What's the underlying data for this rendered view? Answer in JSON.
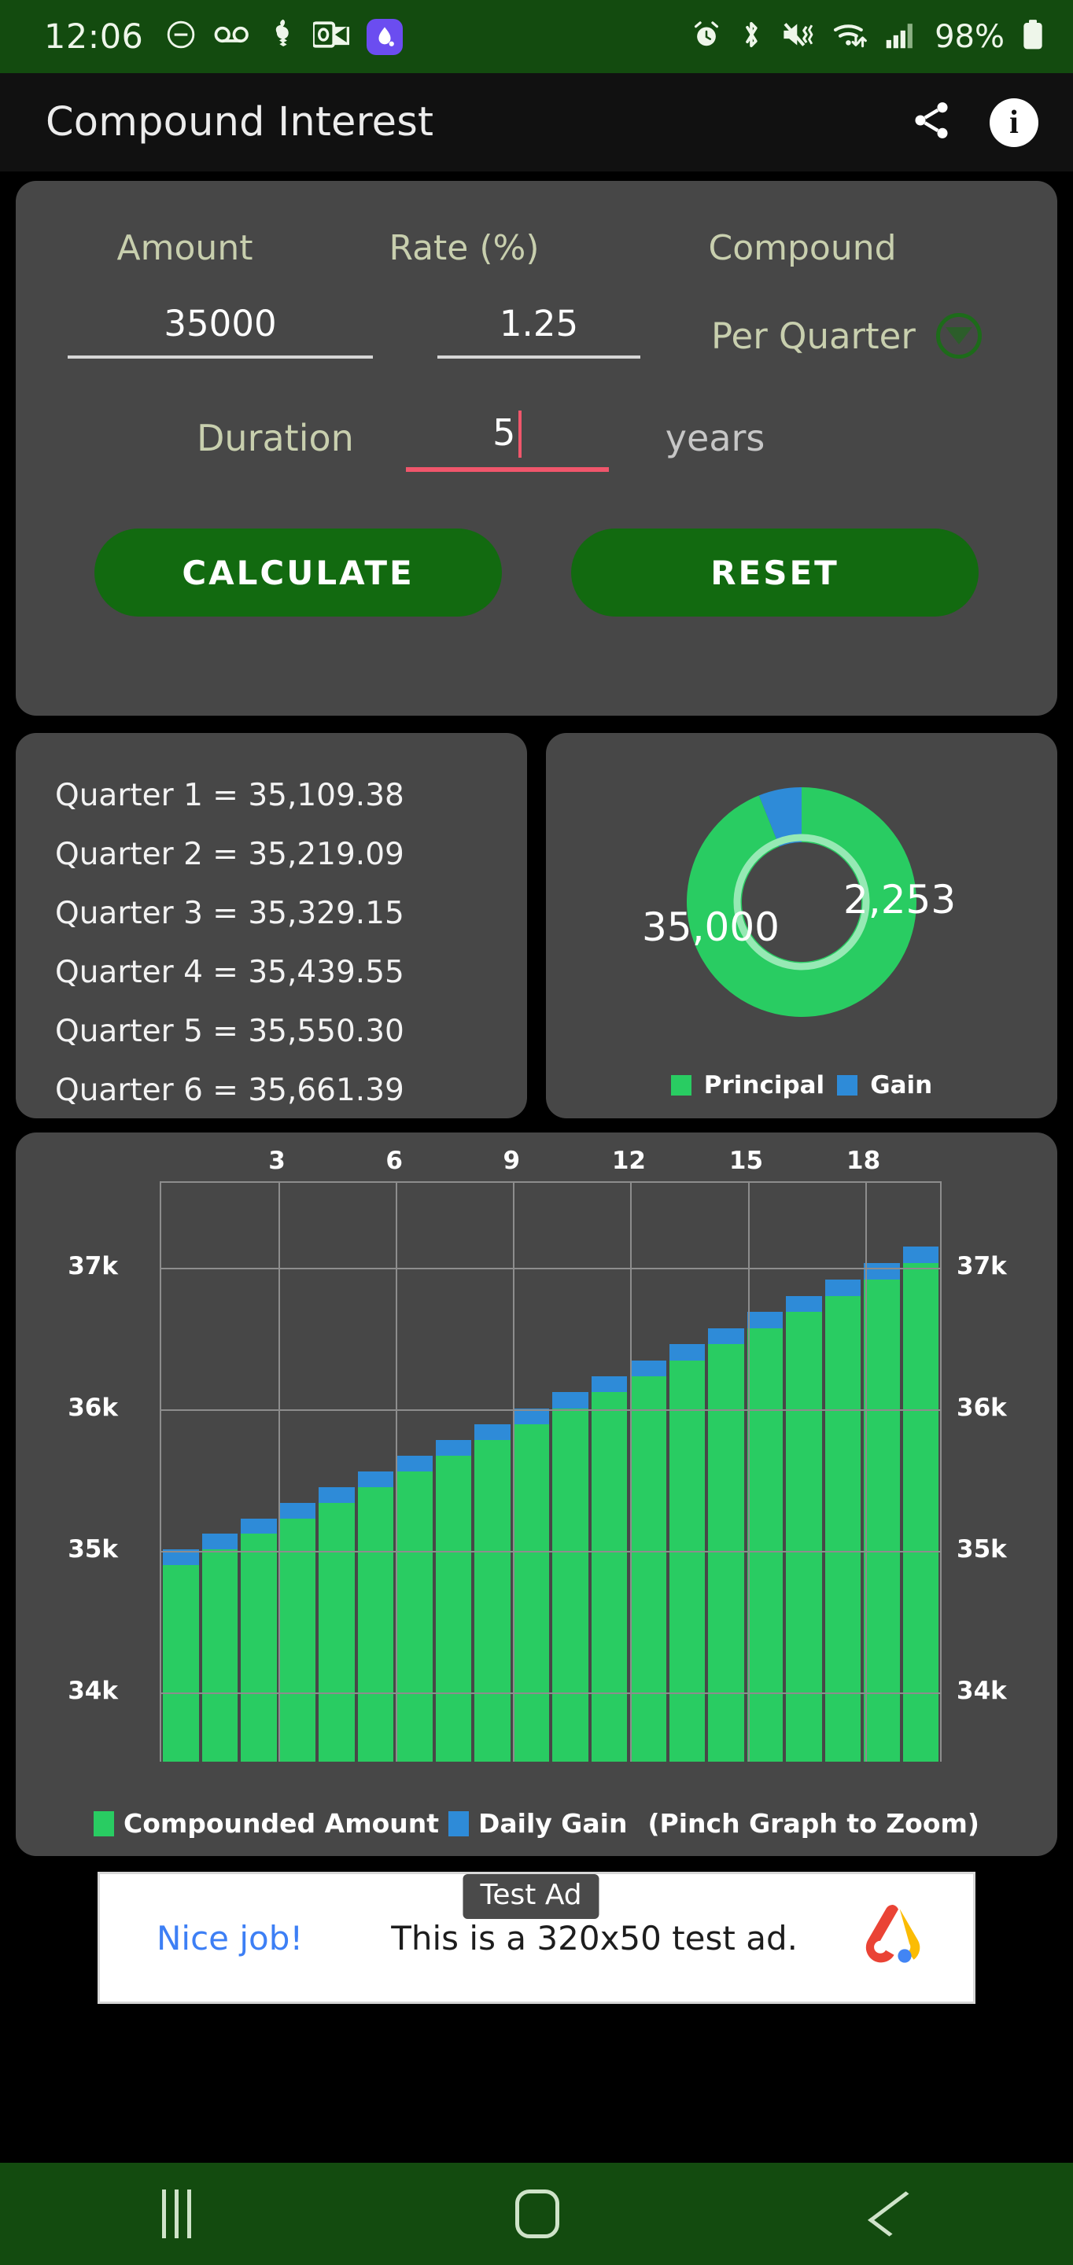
{
  "status_bar": {
    "clock": "12:06",
    "battery_percent": "98%",
    "left_icons": [
      "do-not-disturb-icon",
      "voicemail-icon",
      "app-icon",
      "outlook-icon",
      "purple-app-icon"
    ],
    "right_icons": [
      "alarm-icon",
      "bluetooth-icon",
      "mute-vibrate-icon",
      "wifi-icon",
      "signal-icon",
      "battery-icon"
    ],
    "bg_color": "#134b0f"
  },
  "app_bar": {
    "title": "Compound Interest",
    "share_icon": "share-icon",
    "info_icon": "info-icon",
    "info_glyph": "i"
  },
  "form": {
    "labels": {
      "amount": "Amount",
      "rate": "Rate (%)",
      "compound": "Compound",
      "duration": "Duration",
      "years_unit": "years"
    },
    "values": {
      "amount": "35000",
      "rate": "1.25",
      "compound": "Per Quarter",
      "duration": "5"
    },
    "compound_options": [
      "Per Quarter"
    ],
    "buttons": {
      "calculate": "CALCULATE",
      "reset": "RESET"
    },
    "focused_field": "duration",
    "focus_color": "#f0566b",
    "label_color": "#c8cfae",
    "button_color": "#126a10"
  },
  "quarters": {
    "lines": [
      "Quarter 1 = 35,109.38",
      "Quarter 2 = 35,219.09",
      "Quarter 3 = 35,329.15",
      "Quarter 4 = 35,439.55",
      "Quarter 5 = 35,550.30",
      "Quarter 6 = 35,661.39"
    ]
  },
  "chart_data": [
    {
      "type": "pie",
      "title": "",
      "labels": [
        "Principal",
        "Gain"
      ],
      "values": [
        35000,
        2253
      ],
      "value_labels": [
        "35,000",
        "2,253"
      ],
      "colors": [
        "#29cc62",
        "#2e8bd8"
      ],
      "legend": [
        "Principal",
        "Gain"
      ],
      "legend_position": "bottom",
      "donut": true
    },
    {
      "type": "bar",
      "title": "",
      "xlabel": "",
      "ylabel": "",
      "x_axis_position": "top",
      "categories": [
        "1",
        "2",
        "3",
        "4",
        "5",
        "6",
        "7",
        "8",
        "9",
        "10",
        "11",
        "12",
        "13",
        "14",
        "15",
        "16",
        "17",
        "18",
        "19",
        "20"
      ],
      "xticks": [
        "3",
        "6",
        "9",
        "12",
        "15",
        "18"
      ],
      "yticks": [
        "34k",
        "35k",
        "36k",
        "37k"
      ],
      "ylim": [
        33500,
        37600
      ],
      "grid": true,
      "stacked": true,
      "series": [
        {
          "name": "Compounded Amount",
          "color": "#29cc62",
          "values": [
            35000,
            35109.38,
            35219.09,
            35329.15,
            35439.55,
            35550.3,
            35661.39,
            35772.82,
            35884.61,
            35996.75,
            36109.24,
            36222.08,
            36335.27,
            36448.82,
            36562.74,
            36677.01,
            36791.64,
            36906.63,
            37021.99,
            37137.71
          ]
        },
        {
          "name": "Daily Gain",
          "color": "#2e8bd8",
          "values": [
            109.38,
            109.71,
            110.06,
            110.4,
            110.75,
            111.09,
            111.44,
            111.79,
            112.14,
            112.49,
            112.85,
            113.2,
            113.55,
            113.91,
            114.27,
            114.63,
            114.99,
            115.36,
            115.72,
            116.09
          ]
        }
      ],
      "legend": [
        "Compounded Amount",
        "Daily Gain"
      ],
      "legend_hint": "(Pinch Graph to Zoom)",
      "legend_position": "bottom"
    }
  ],
  "ad": {
    "badge": "Test Ad",
    "cta": "Nice job!",
    "body": "This is a 320x50 test ad.",
    "logo": "admob-logo-icon"
  },
  "nav_bar": {
    "recents": "recents-icon",
    "home": "home-icon",
    "back": "back-icon",
    "bg_color": "#134b0f"
  }
}
